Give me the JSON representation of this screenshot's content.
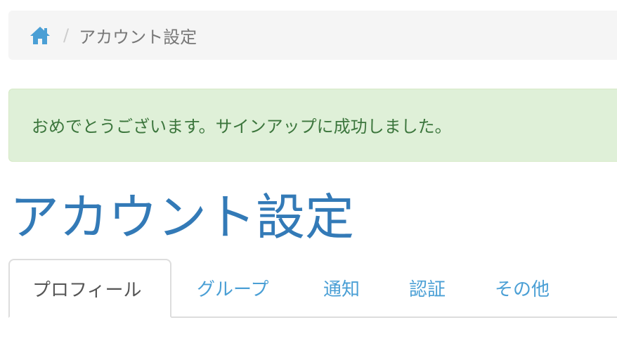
{
  "breadcrumb": {
    "home_icon": "home-icon",
    "separator": "/",
    "current": "アカウント設定"
  },
  "alert": {
    "message": "おめでとうございます。サインアップに成功しました。"
  },
  "page": {
    "title": "アカウント設定"
  },
  "tabs": [
    {
      "label": "プロフィール",
      "active": true
    },
    {
      "label": "グループ",
      "active": false
    },
    {
      "label": "通知",
      "active": false
    },
    {
      "label": "認証",
      "active": false
    },
    {
      "label": "その他",
      "active": false
    }
  ],
  "colors": {
    "link": "#4a9fd5",
    "title": "#337ab7",
    "alert_bg": "#dff0d8",
    "alert_text": "#3c763d"
  }
}
